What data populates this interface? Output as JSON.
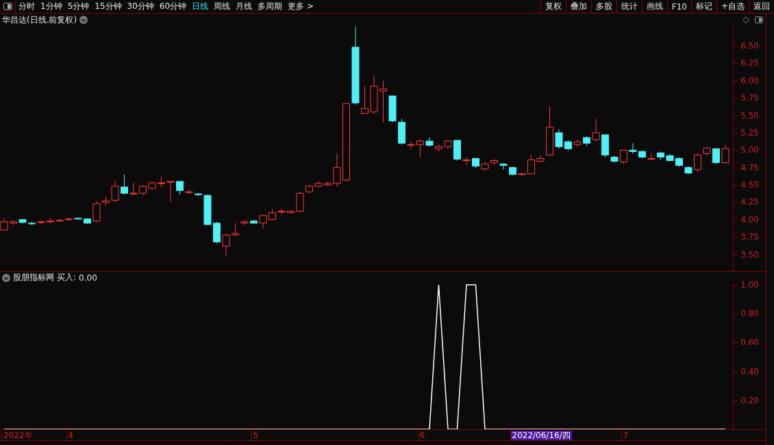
{
  "toolbar": {
    "periods": [
      {
        "label": "分时",
        "selected": false
      },
      {
        "label": "1分钟",
        "selected": false
      },
      {
        "label": "5分钟",
        "selected": false
      },
      {
        "label": "15分钟",
        "selected": false
      },
      {
        "label": "30分钟",
        "selected": false
      },
      {
        "label": "60分钟",
        "selected": false
      },
      {
        "label": "日线",
        "selected": true
      },
      {
        "label": "周线",
        "selected": false
      },
      {
        "label": "月线",
        "selected": false
      },
      {
        "label": "多周期",
        "selected": false
      },
      {
        "label": "更多 >",
        "selected": false
      }
    ],
    "actions": [
      "复权",
      "叠加",
      "多股",
      "统计",
      "画线",
      "F10",
      "标记",
      "+自选",
      "返回"
    ]
  },
  "price_chart": {
    "title": "华昌达(日线.前复权)",
    "chart_data": {
      "type": "candlestick",
      "ylim": [
        3.26,
        6.785
      ],
      "grid": true,
      "yticks": [
        {
          "value": 6.5,
          "label": "6.50"
        },
        {
          "value": 6.25,
          "label": "6.25"
        },
        {
          "value": 6,
          "label": "6.00"
        },
        {
          "value": 5.75,
          "label": "5.75"
        },
        {
          "value": 5.5,
          "label": "5.50"
        },
        {
          "value": 5.25,
          "label": "5.25"
        },
        {
          "value": 5,
          "label": "5.00"
        },
        {
          "value": 4.75,
          "label": "4.75"
        },
        {
          "value": 4.5,
          "label": "4.50"
        },
        {
          "value": 4.25,
          "label": "4.25"
        },
        {
          "value": 4,
          "label": "4.00"
        },
        {
          "value": 3.75,
          "label": "3.75"
        },
        {
          "value": 3.5,
          "label": "3.50"
        }
      ],
      "ohlc": [
        [
          3.85,
          4.02,
          3.85,
          3.97
        ],
        [
          3.95,
          3.99,
          3.92,
          3.97
        ],
        [
          4.0,
          4.01,
          3.95,
          3.96
        ],
        [
          3.95,
          3.97,
          3.92,
          3.94
        ],
        [
          3.96,
          3.99,
          3.93,
          3.97
        ],
        [
          3.97,
          4.02,
          3.95,
          3.98
        ],
        [
          3.98,
          4.01,
          3.97,
          3.99
        ],
        [
          4.0,
          4.03,
          3.99,
          4.01
        ],
        [
          4.02,
          4.03,
          4.0,
          4.01
        ],
        [
          4.01,
          4.02,
          3.94,
          3.95
        ],
        [
          3.98,
          4.27,
          3.96,
          4.23
        ],
        [
          4.25,
          4.33,
          4.2,
          4.27
        ],
        [
          4.28,
          4.56,
          4.25,
          4.48
        ],
        [
          4.47,
          4.65,
          4.36,
          4.38
        ],
        [
          4.37,
          4.53,
          4.35,
          4.38
        ],
        [
          4.38,
          4.5,
          4.35,
          4.48
        ],
        [
          4.45,
          4.55,
          4.43,
          4.53
        ],
        [
          4.52,
          4.62,
          4.47,
          4.53
        ],
        [
          4.55,
          4.55,
          4.25,
          4.55
        ],
        [
          4.55,
          4.55,
          4.36,
          4.42
        ],
        [
          4.4,
          4.43,
          4.37,
          4.4
        ],
        [
          4.37,
          4.38,
          4.34,
          4.36
        ],
        [
          4.35,
          4.36,
          3.92,
          3.93
        ],
        [
          3.95,
          3.97,
          3.66,
          3.68
        ],
        [
          3.62,
          3.8,
          3.48,
          3.78
        ],
        [
          3.78,
          3.95,
          3.77,
          3.8
        ],
        [
          3.95,
          4.0,
          3.92,
          3.97
        ],
        [
          3.98,
          4.0,
          3.94,
          3.95
        ],
        [
          3.95,
          4.07,
          3.87,
          4.06
        ],
        [
          4.0,
          4.15,
          3.99,
          4.1
        ],
        [
          4.12,
          4.16,
          4.08,
          4.12
        ],
        [
          4.1,
          4.14,
          4.09,
          4.12
        ],
        [
          4.12,
          4.4,
          4.11,
          4.38
        ],
        [
          4.4,
          4.5,
          4.38,
          4.48
        ],
        [
          4.48,
          4.55,
          4.46,
          4.52
        ],
        [
          4.5,
          4.55,
          4.48,
          4.52
        ],
        [
          4.52,
          4.95,
          4.48,
          4.75
        ],
        [
          4.57,
          5.67,
          4.55,
          5.67
        ],
        [
          6.48,
          6.78,
          5.65,
          5.68
        ],
        [
          5.53,
          5.92,
          5.53,
          5.6
        ],
        [
          5.55,
          6.08,
          5.52,
          5.92
        ],
        [
          5.85,
          6.0,
          5.4,
          5.88
        ],
        [
          5.78,
          5.78,
          5.4,
          5.42
        ],
        [
          5.4,
          5.45,
          5.08,
          5.1
        ],
        [
          5.08,
          5.12,
          5.02,
          5.08
        ],
        [
          5.08,
          5.15,
          4.9,
          5.13
        ],
        [
          5.13,
          5.18,
          5.05,
          5.07
        ],
        [
          5.02,
          5.08,
          4.98,
          5.05
        ],
        [
          5.05,
          5.15,
          5.02,
          5.13
        ],
        [
          5.14,
          5.15,
          4.85,
          4.87
        ],
        [
          4.85,
          4.9,
          4.78,
          4.86
        ],
        [
          4.88,
          4.89,
          4.75,
          4.77
        ],
        [
          4.73,
          4.83,
          4.7,
          4.8
        ],
        [
          4.82,
          4.88,
          4.79,
          4.85
        ],
        [
          4.8,
          4.81,
          4.72,
          4.78
        ],
        [
          4.75,
          4.76,
          4.64,
          4.65
        ],
        [
          4.65,
          4.67,
          4.63,
          4.66
        ],
        [
          4.66,
          4.93,
          4.65,
          4.86
        ],
        [
          4.84,
          4.93,
          4.82,
          4.88
        ],
        [
          4.93,
          5.63,
          4.92,
          5.33
        ],
        [
          5.25,
          5.3,
          5.02,
          5.05
        ],
        [
          5.12,
          5.14,
          5.0,
          5.02
        ],
        [
          5.08,
          5.15,
          5.05,
          5.12
        ],
        [
          5.18,
          5.2,
          5.06,
          5.1
        ],
        [
          5.15,
          5.45,
          5.12,
          5.25
        ],
        [
          5.22,
          5.23,
          4.9,
          4.93
        ],
        [
          4.9,
          4.92,
          4.82,
          4.84
        ],
        [
          4.83,
          5.0,
          4.8,
          5.0
        ],
        [
          5.0,
          5.1,
          4.95,
          4.98
        ],
        [
          4.98,
          5.0,
          4.88,
          4.9
        ],
        [
          4.88,
          4.96,
          4.85,
          4.88
        ],
        [
          4.96,
          4.98,
          4.86,
          4.9
        ],
        [
          4.92,
          4.95,
          4.84,
          4.85
        ],
        [
          4.88,
          4.9,
          4.76,
          4.78
        ],
        [
          4.75,
          4.77,
          4.65,
          4.67
        ],
        [
          4.72,
          4.95,
          4.68,
          4.93
        ],
        [
          4.95,
          5.05,
          4.92,
          5.03
        ],
        [
          5.02,
          5.03,
          4.8,
          4.82
        ],
        [
          4.82,
          5.08,
          4.8,
          5.02
        ]
      ]
    }
  },
  "indicator": {
    "title": "股朋指标网",
    "reading_label": "买入:",
    "reading": "0.00",
    "chart_data": {
      "type": "line",
      "ylim": [
        0,
        1.01
      ],
      "grid": true,
      "yticks": [
        {
          "value": 1,
          "label": "1.00"
        },
        {
          "value": 0.8,
          "label": "0.80"
        },
        {
          "value": 0.6,
          "label": "0.60"
        },
        {
          "value": 0.4,
          "label": "0.40"
        },
        {
          "value": 0.2,
          "label": "0.20"
        }
      ],
      "series": [
        {
          "color": "#ffffff",
          "values": [
            0,
            0,
            0,
            0,
            0,
            0,
            0,
            0,
            0,
            0,
            0,
            0,
            0,
            0,
            0,
            0,
            0,
            0,
            0,
            0,
            0,
            0,
            0,
            0,
            0,
            0,
            0,
            0,
            0,
            0,
            0,
            0,
            0,
            0,
            0,
            0,
            0,
            0,
            0,
            0,
            0,
            0,
            0,
            0,
            0,
            0,
            0,
            1,
            0,
            0,
            1,
            1,
            0,
            0,
            0,
            0,
            0,
            0,
            0,
            0,
            0,
            0,
            0,
            0,
            0,
            0,
            0,
            0,
            0,
            0,
            0,
            0,
            0,
            0,
            0,
            0,
            0,
            0,
            0
          ]
        }
      ]
    }
  },
  "date_axis": [
    {
      "label": "2022年",
      "kind": "month"
    },
    {
      "label": "4",
      "kind": "month"
    },
    {
      "label": "5",
      "kind": "month"
    },
    {
      "label": "6",
      "kind": "month"
    },
    {
      "label": "2022/06/16/四",
      "kind": "cursor"
    },
    {
      "label": "7",
      "kind": "month"
    }
  ]
}
